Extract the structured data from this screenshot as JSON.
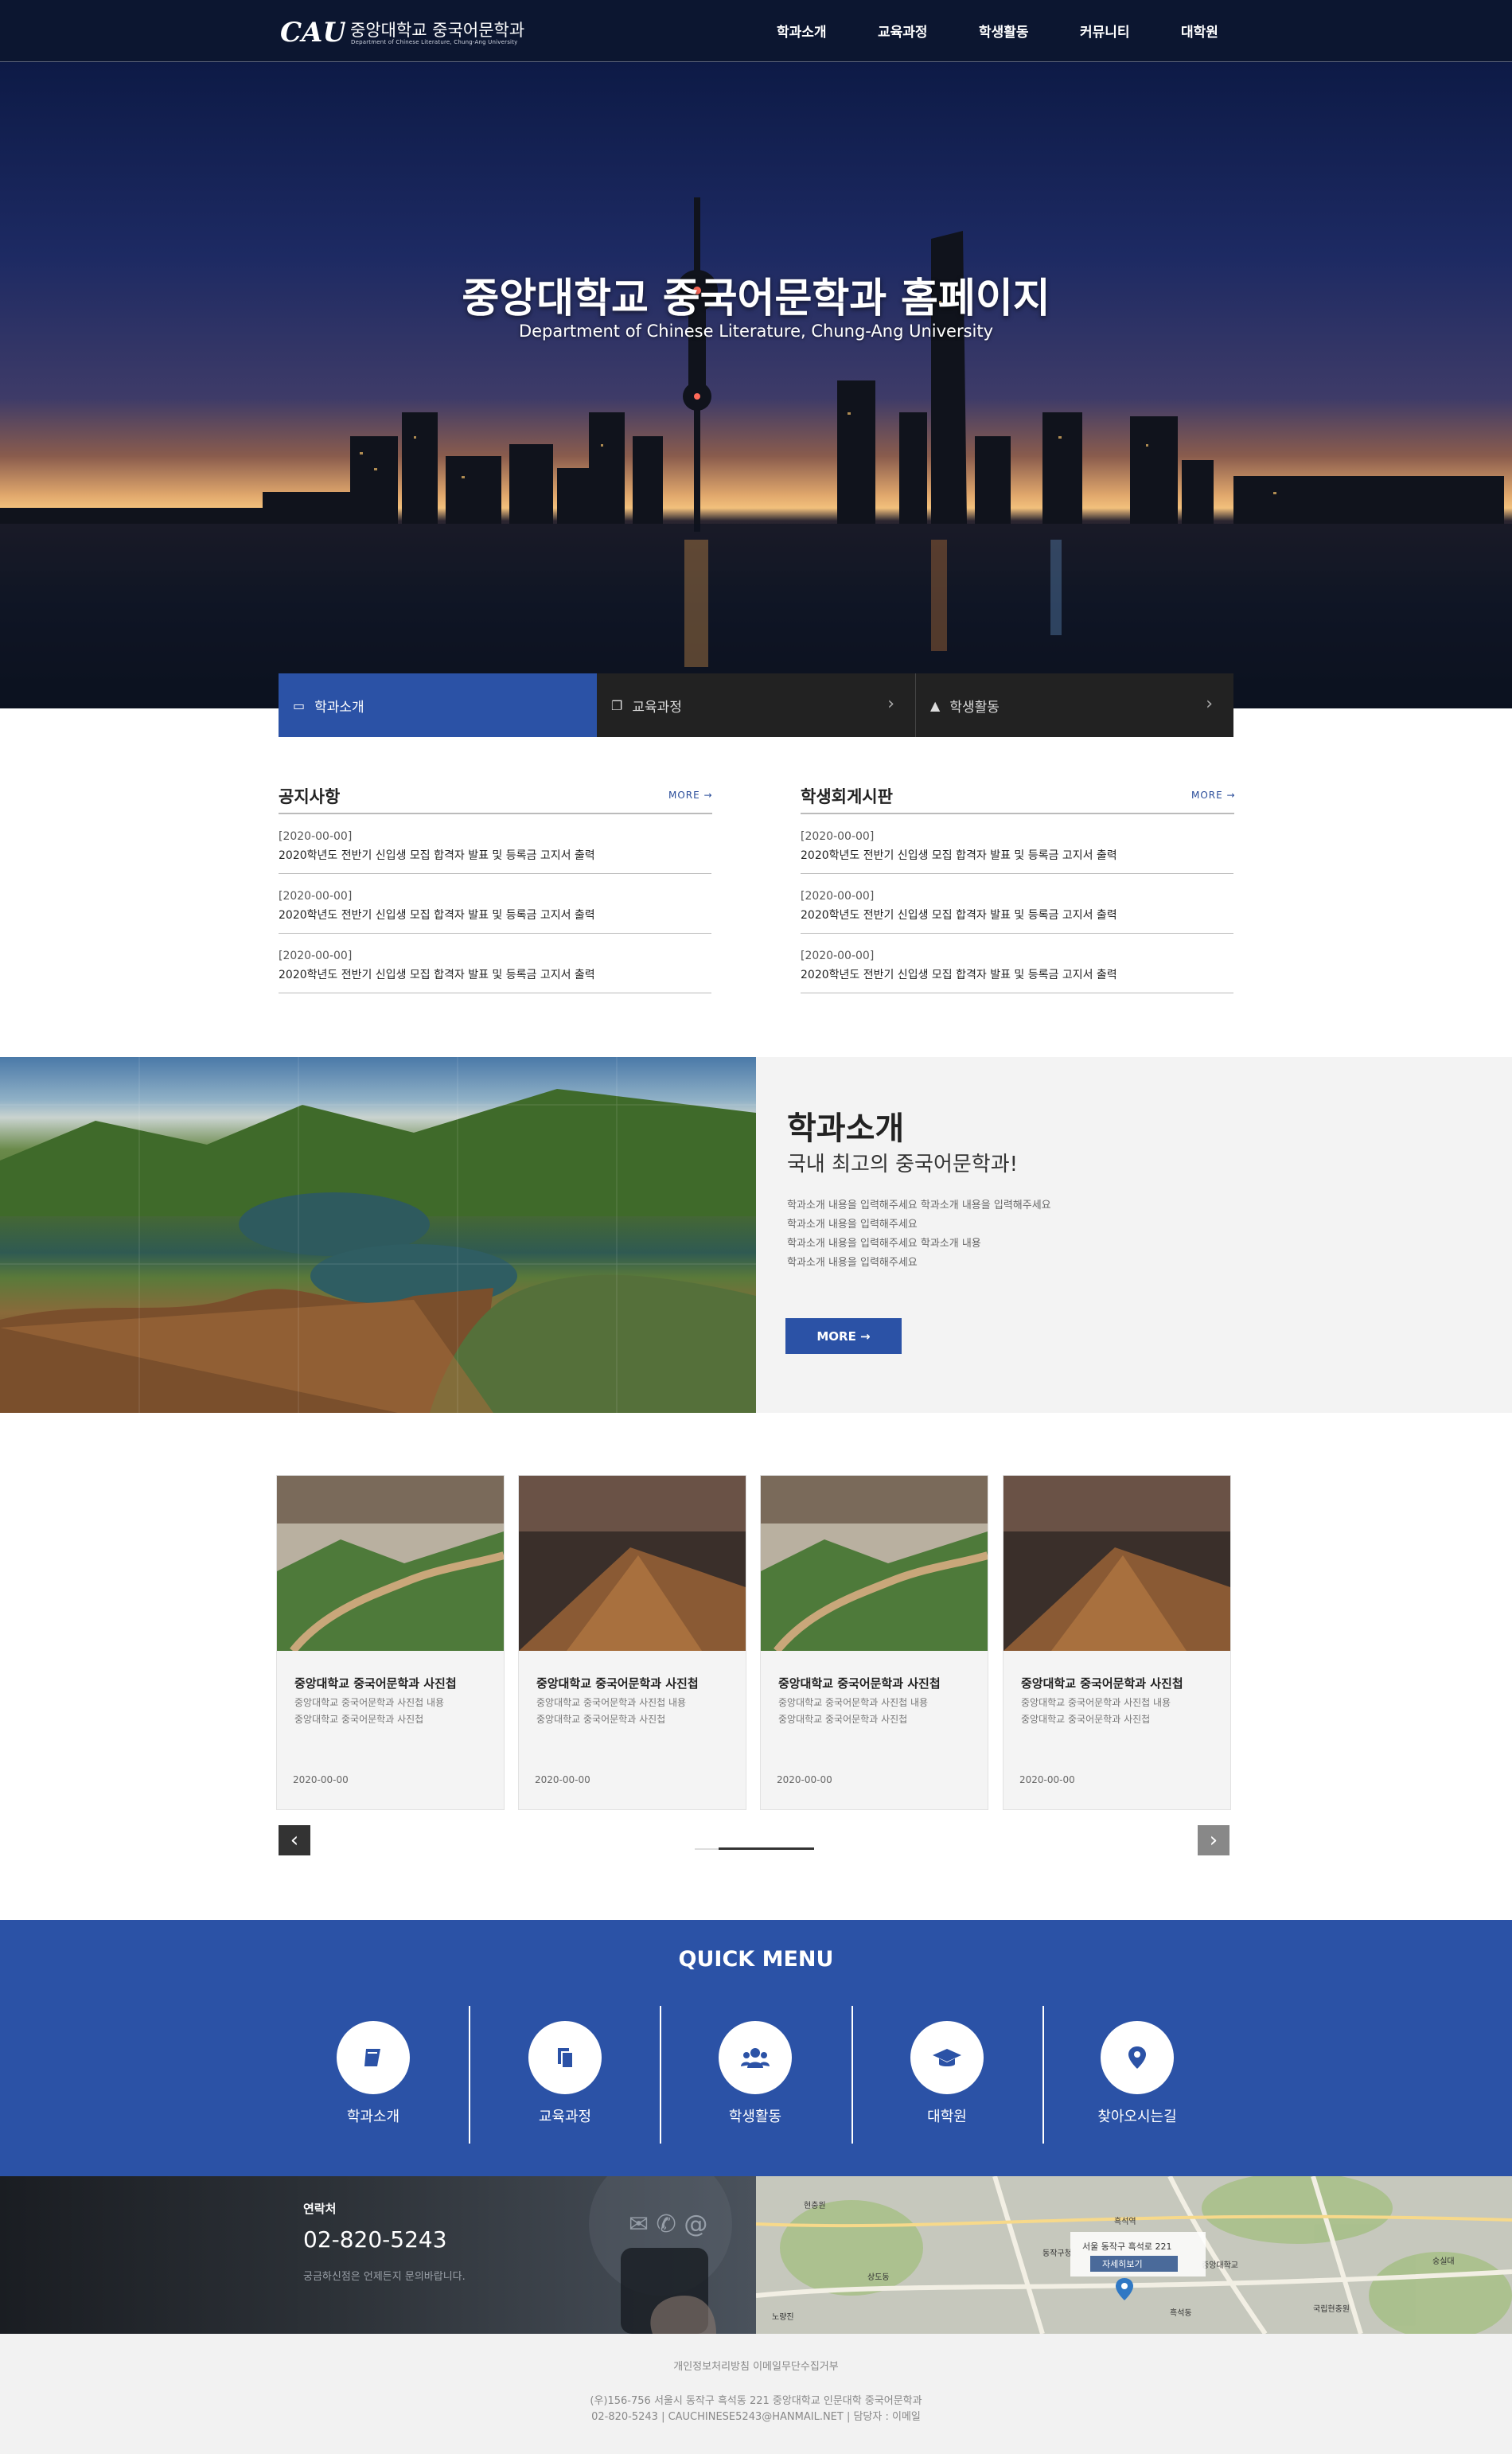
{
  "header": {
    "logo_mark": "CAU",
    "logo_title": "중앙대학교 중국어문학과",
    "logo_subtitle": "Department of Chinese Literature, Chung-Ang University",
    "nav": [
      "학과소개",
      "교육과정",
      "학생활동",
      "커뮤니티",
      "대학원"
    ]
  },
  "hero": {
    "title": "중앙대학교 중국어문학과 홈페이지",
    "subtitle": "Department of Chinese Literature, Chung-Ang University"
  },
  "tabs": [
    {
      "label": "학과소개",
      "icon": "book-icon",
      "active": true
    },
    {
      "label": "교육과정",
      "icon": "documents-icon",
      "active": false
    },
    {
      "label": "학생활동",
      "icon": "graduation-cap-icon",
      "active": false
    }
  ],
  "boards": [
    {
      "title": "공지사항",
      "more": "MORE →",
      "posts": [
        {
          "date": "[2020-00-00]",
          "title": "2020학년도 전반기 신입생 모집 합격자 발표 및 등록금 고지서 출력"
        },
        {
          "date": "[2020-00-00]",
          "title": "2020학년도 전반기 신입생 모집 합격자 발표 및 등록금 고지서 출력"
        },
        {
          "date": "[2020-00-00]",
          "title": "2020학년도 전반기 신입생 모집 합격자 발표 및 등록금 고지서 출력"
        }
      ]
    },
    {
      "title": "학생회게시판",
      "more": "MORE →",
      "posts": [
        {
          "date": "[2020-00-00]",
          "title": "2020학년도 전반기 신입생 모집 합격자 발표 및 등록금 고지서 출력"
        },
        {
          "date": "[2020-00-00]",
          "title": "2020학년도 전반기 신입생 모집 합격자 발표 및 등록금 고지서 출력"
        },
        {
          "date": "[2020-00-00]",
          "title": "2020학년도 전반기 신입생 모집 합격자 발표 및 등록금 고지서 출력"
        }
      ]
    }
  ],
  "intro": {
    "title": "학과소개",
    "subtitle": "국내 최고의 중국어문학과!",
    "lines": [
      "학과소개 내용을 입력해주세요 학과소개 내용을 입력해주세요",
      "학과소개 내용을 입력해주세요",
      "학과소개 내용을 입력해주세요 학과소개 내용",
      "학과소개 내용을 입력해주세요"
    ],
    "button": "MORE →"
  },
  "gallery": {
    "cards": [
      {
        "title": "중앙대학교 중국어문학과 사진첩",
        "desc1": "중앙대학교 중국어문학과 사진첩 내용",
        "desc2": "중앙대학교 중국어문학과 사진첩",
        "date": "2020-00-00"
      },
      {
        "title": "중앙대학교 중국어문학과 사진첩",
        "desc1": "중앙대학교 중국어문학과 사진첩 내용",
        "desc2": "중앙대학교 중국어문학과 사진첩",
        "date": "2020-00-00"
      },
      {
        "title": "중앙대학교 중국어문학과 사진첩",
        "desc1": "중앙대학교 중국어문학과 사진첩 내용",
        "desc2": "중앙대학교 중국어문학과 사진첩",
        "date": "2020-00-00"
      },
      {
        "title": "중앙대학교 중국어문학과 사진첩",
        "desc1": "중앙대학교 중국어문학과 사진첩 내용",
        "desc2": "중앙대학교 중국어문학과 사진첩",
        "date": "2020-00-00"
      }
    ],
    "prev": "‹",
    "next": "›"
  },
  "quick_menu": {
    "title": "QUICK MENU",
    "items": [
      {
        "label": "학과소개",
        "icon": "book-icon"
      },
      {
        "label": "교육과정",
        "icon": "documents-icon"
      },
      {
        "label": "학생활동",
        "icon": "users-icon"
      },
      {
        "label": "대학원",
        "icon": "graduation-cap-icon"
      },
      {
        "label": "찾아오시는길",
        "icon": "map-pin-icon"
      }
    ]
  },
  "contact": {
    "label": "연락처",
    "phone": "02-820-5243",
    "note": "궁금하신점은 언제든지 문의바랍니다."
  },
  "map": {
    "address_label": "서울 동작구 흑석로 221",
    "view_button": "자세히보기",
    "places": [
      "중앙대학교",
      "흑석역",
      "현충원",
      "동작구청",
      "상도동",
      "노량진",
      "흑석동",
      "국립현충원",
      "숭실대"
    ]
  },
  "footer": {
    "links": "개인정보처리방침   이메일무단수집거부",
    "address": "(우)156-756 서울시 동작구 흑석동 221 중앙대학교 인문대학 중국어문학과",
    "contact": "02-820-5243 | CAUCHINESE5243@HANMAIL.NET | 담당자 : 이메일"
  },
  "colors": {
    "brand_blue": "#2b52a6",
    "header_navy": "#0c1630",
    "tab_dark": "#222222"
  }
}
